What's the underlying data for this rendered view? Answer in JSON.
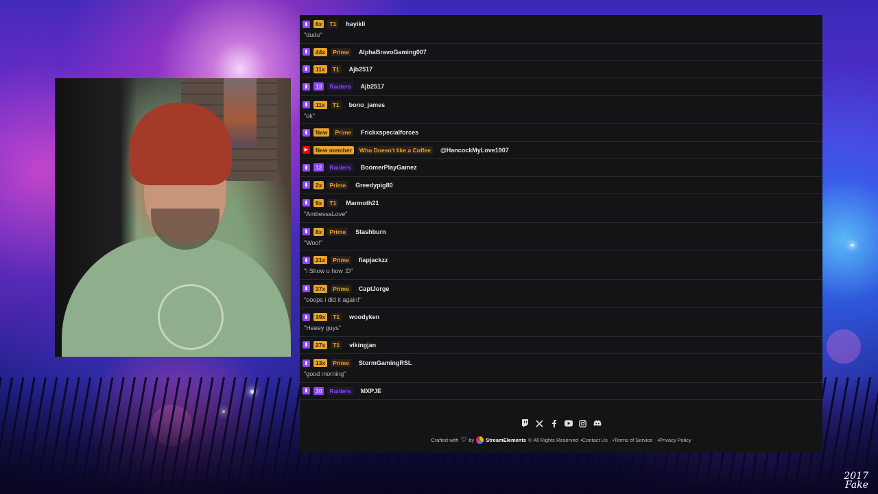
{
  "chat": {
    "rows": [
      {
        "platform": "twitch",
        "count": "6x",
        "tier": "T1",
        "user": "hayikli",
        "message": "\"dudu\""
      },
      {
        "platform": "twitch",
        "count": "44x",
        "tier": "Prime",
        "user": "AlphaBravoGaming007",
        "message": ""
      },
      {
        "platform": "twitch",
        "count": "11x",
        "tier": "T1",
        "user": "Ajb2517",
        "message": ""
      },
      {
        "platform": "twitch",
        "count": "13",
        "tier": "Raiders",
        "user": "Ajb2517",
        "message": "",
        "variant": "raid"
      },
      {
        "platform": "twitch",
        "count": "11x",
        "tier": "T1",
        "user": "bono_james",
        "message": "\"ok\""
      },
      {
        "platform": "twitch",
        "count": "New",
        "tier": "Prime",
        "user": "Frickxspecialforces",
        "message": ""
      },
      {
        "platform": "youtube",
        "count": "New member",
        "tier": "Who Doesn't like a Coffee",
        "user": "@HancockMyLove1907",
        "message": "",
        "variant": "yt"
      },
      {
        "platform": "twitch",
        "count": "12",
        "tier": "Raiders",
        "user": "BoomerPlayGamez",
        "message": "",
        "variant": "raid"
      },
      {
        "platform": "twitch",
        "count": "2x",
        "tier": "Prime",
        "user": "Greedypig80",
        "message": ""
      },
      {
        "platform": "twitch",
        "count": "9x",
        "tier": "T1",
        "user": "Marmoth21",
        "message": "\"AmbessaLove\""
      },
      {
        "platform": "twitch",
        "count": "8x",
        "tier": "Prime",
        "user": "Stashburn",
        "message": "\"Woo!\""
      },
      {
        "platform": "twitch",
        "count": "21x",
        "tier": "Prime",
        "user": "fiapjackzz",
        "message": "\"i Show u how :D\""
      },
      {
        "platform": "twitch",
        "count": "37x",
        "tier": "Prime",
        "user": "CaptJorge",
        "message": "\"ooops i did it again!\""
      },
      {
        "platform": "twitch",
        "count": "39x",
        "tier": "T1",
        "user": "woodyken",
        "message": "\"Heeey guys\""
      },
      {
        "platform": "twitch",
        "count": "27x",
        "tier": "T1",
        "user": "vikingjan",
        "message": ""
      },
      {
        "platform": "twitch",
        "count": "13x",
        "tier": "Prime",
        "user": "StormGamingRSL",
        "message": "\"good morning\""
      },
      {
        "platform": "twitch",
        "count": "30",
        "tier": "Raiders",
        "user": "MXPJE",
        "message": "",
        "variant": "raid"
      }
    ]
  },
  "footer": {
    "socials": [
      "twitch-icon",
      "x-icon",
      "facebook-icon",
      "youtube-icon",
      "instagram-icon",
      "discord-icon"
    ],
    "crafted": "Crafted with",
    "by": "by",
    "brand": "StreamElements",
    "rights": "© All Rights Reserved",
    "contact": "•Contact Us",
    "terms": "•Terms of Service",
    "privacy": "•Privacy Policy"
  },
  "signature": {
    "line1": "2017",
    "line2": "Fake"
  },
  "colors": {
    "twitch": "#9146ff",
    "youtube": "#ff0000",
    "gold": "#e7a32a",
    "panel": "#141416"
  }
}
